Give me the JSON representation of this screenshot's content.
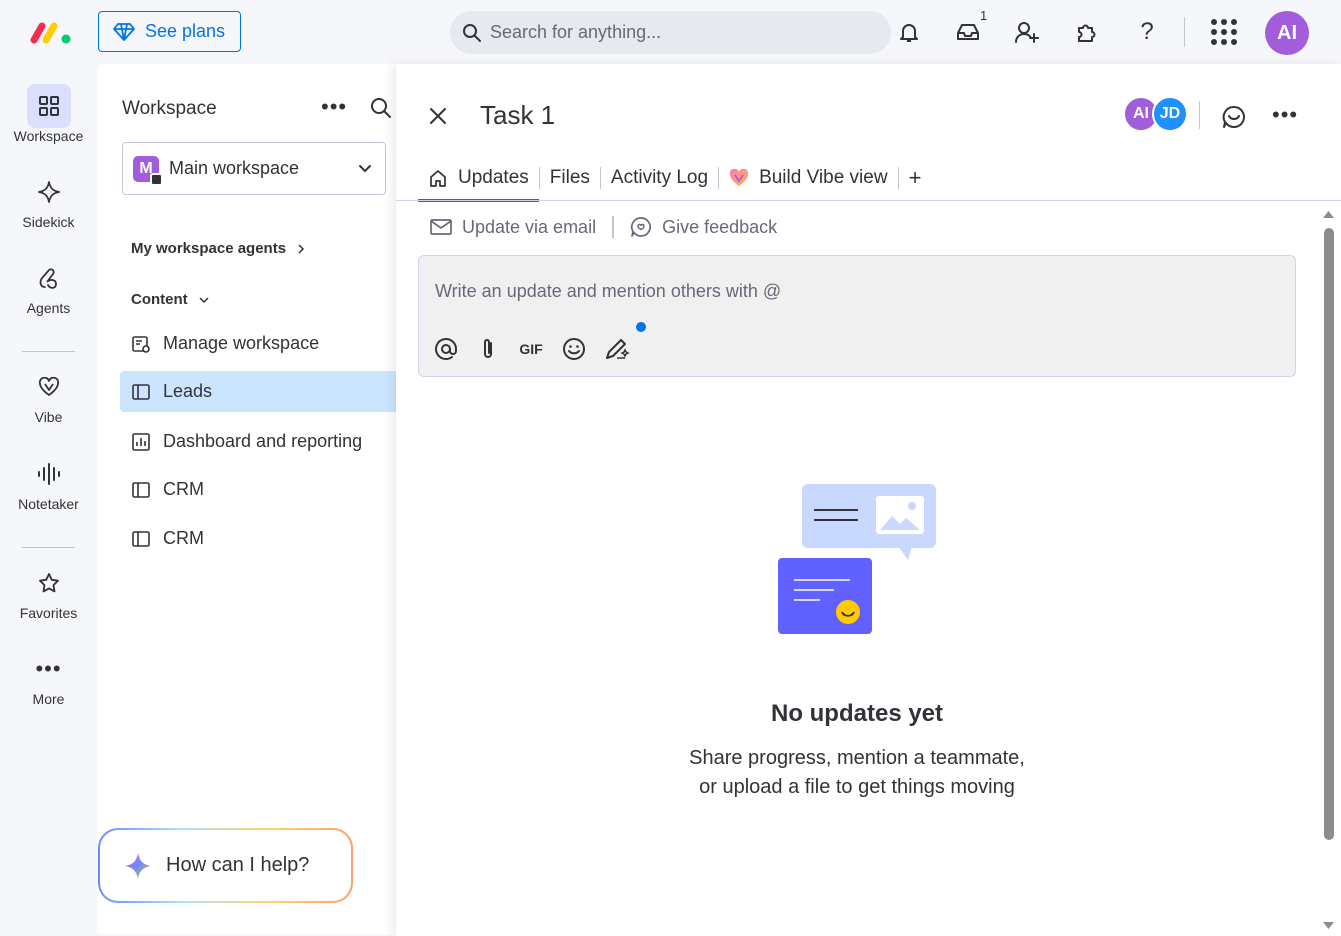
{
  "header": {
    "see_plans": "See plans",
    "search_placeholder": "Search for anything...",
    "inbox_badge": "1",
    "user_initials": "AI"
  },
  "rail": {
    "items": [
      {
        "label": "Workspace"
      },
      {
        "label": "Sidekick"
      },
      {
        "label": "Agents"
      },
      {
        "label": "Vibe"
      },
      {
        "label": "Notetaker"
      },
      {
        "label": "Favorites"
      },
      {
        "label": "More"
      }
    ]
  },
  "workspace": {
    "title": "Workspace",
    "selected": "Main workspace",
    "selected_initial": "M",
    "agents_section": "My workspace agents",
    "content_section": "Content",
    "items": [
      {
        "label": "Manage workspace"
      },
      {
        "label": "Leads"
      },
      {
        "label": "Dashboard and reporting"
      },
      {
        "label": "CRM"
      },
      {
        "label": "CRM"
      }
    ]
  },
  "assistant": {
    "label": "How can I help?"
  },
  "panel": {
    "title": "Task 1",
    "avatars": [
      "AI",
      "JD"
    ],
    "tabs": [
      {
        "label": "Updates"
      },
      {
        "label": "Files"
      },
      {
        "label": "Activity Log"
      },
      {
        "label": "Build Vibe view"
      }
    ],
    "add_tab": "+",
    "update_email": "Update via email",
    "give_feedback": "Give feedback",
    "editor_placeholder": "Write an update and mention others with @",
    "gif_label": "GIF",
    "empty_title": "No updates yet",
    "empty_line1": "Share progress, mention a teammate,",
    "empty_line2": "or upload a file to get things moving"
  },
  "colors": {
    "accent": "#0073ea",
    "active_nav": "#cce5ff",
    "avatar_ai": "#a25ddc",
    "avatar_jd": "#1e90ff"
  }
}
